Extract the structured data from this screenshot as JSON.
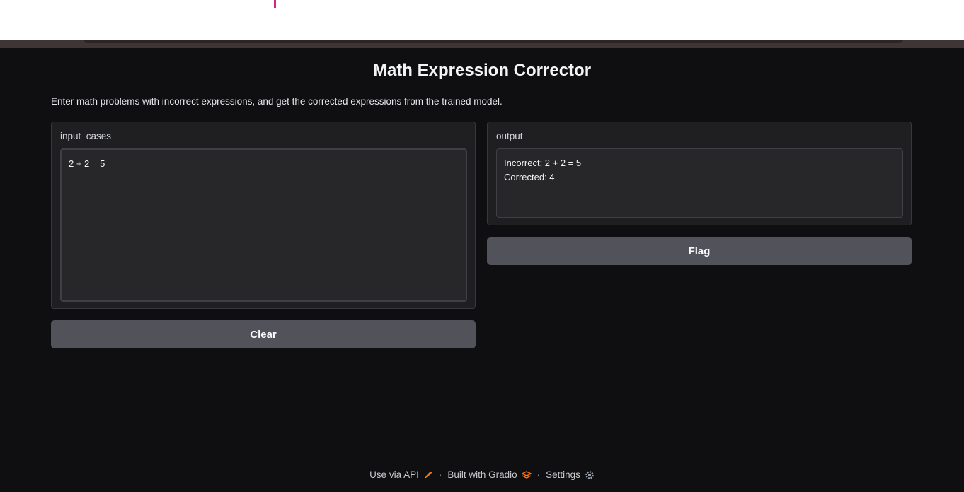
{
  "app": {
    "title": "Math Expression Corrector",
    "description": "Enter math problems with incorrect expressions, and get the corrected expressions from the trained model."
  },
  "input_panel": {
    "label": "input_cases",
    "value": "2 + 2 = 5"
  },
  "output_panel": {
    "label": "output",
    "lines": [
      "Incorrect: 2 + 2 = 5",
      "Corrected: 4"
    ]
  },
  "buttons": {
    "clear_label": "Clear",
    "flag_label": "Flag"
  },
  "footer": {
    "api_label": "Use via API",
    "built_label": "Built with Gradio",
    "settings_label": "Settings",
    "separator": "·"
  },
  "colors": {
    "background": "#0f0f11",
    "panel": "#1f1f22",
    "button": "#52525b",
    "accent_orange": "#f97316"
  }
}
